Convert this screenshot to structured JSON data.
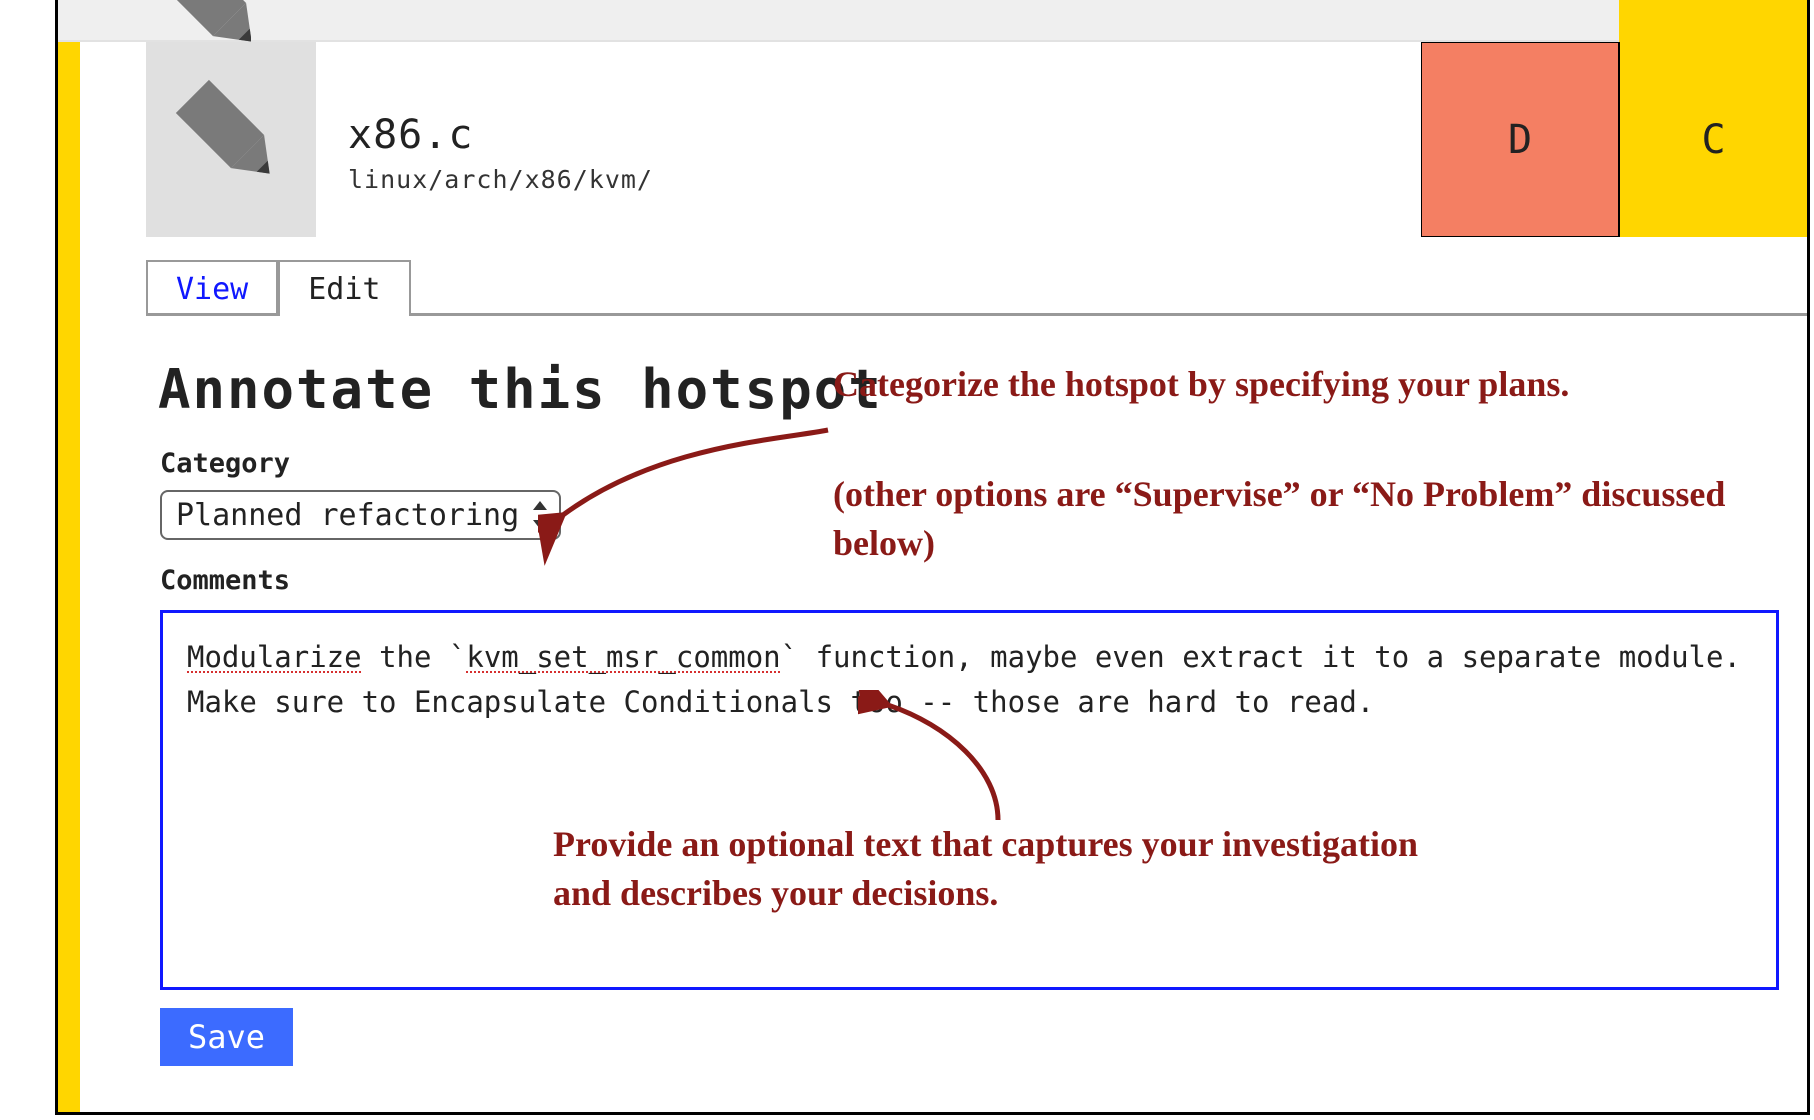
{
  "header": {
    "filename": "x86.c",
    "path": "linux/arch/x86/kvm/",
    "score_d": "D",
    "score_c": "C"
  },
  "tabs": {
    "view": "View",
    "edit": "Edit"
  },
  "form": {
    "heading": "Annotate this hotspot",
    "category_label": "Category",
    "category_value": "Planned refactoring",
    "category_options": [
      "Planned refactoring",
      "Supervise",
      "No Problem"
    ],
    "comments_label": "Comments",
    "comments_prefix": "Modularize",
    "comments_code": "kvm_set_msr_common",
    "comments_mid": "` function, maybe even extract it to a separate module.\nMake sure to Encapsulate Conditionals too -- those are hard to read.",
    "save_label": "Save"
  },
  "annotations": {
    "a1": "Categorize the hotspot by specifying your plans.",
    "a2": "(other options are “Supervise” or “No Problem” discussed below)",
    "a3": "Provide an optional text that captures your investigation and describes your decisions."
  },
  "colors": {
    "yellow": "#ffd600",
    "salmon": "#f47f63",
    "blue_link": "#1018ff",
    "anno_red": "#8a1a17",
    "save_blue": "#3c6bff"
  }
}
